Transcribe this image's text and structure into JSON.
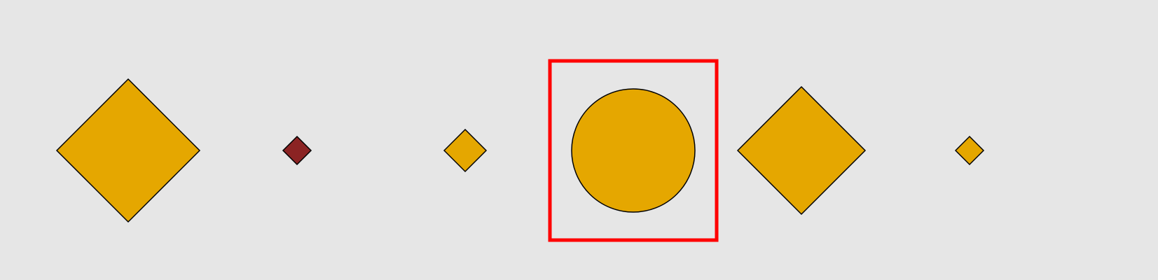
{
  "canvas": {
    "background": "#e6e6e6"
  },
  "colors": {
    "gold": "#e5a700",
    "dark_red": "#8b2323",
    "outline": "#000000",
    "highlight": "#ff0000"
  },
  "shapes": [
    {
      "name": "large-gold-diamond",
      "kind": "diamond",
      "fill_key": "gold"
    },
    {
      "name": "small-red-diamond",
      "kind": "diamond",
      "fill_key": "dark_red"
    },
    {
      "name": "small-gold-diamond",
      "kind": "diamond",
      "fill_key": "gold"
    },
    {
      "name": "gold-circle",
      "kind": "circle",
      "fill_key": "gold",
      "highlighted": true
    },
    {
      "name": "medium-gold-diamond",
      "kind": "diamond",
      "fill_key": "gold"
    },
    {
      "name": "tiny-gold-diamond",
      "kind": "diamond",
      "fill_key": "gold"
    }
  ]
}
